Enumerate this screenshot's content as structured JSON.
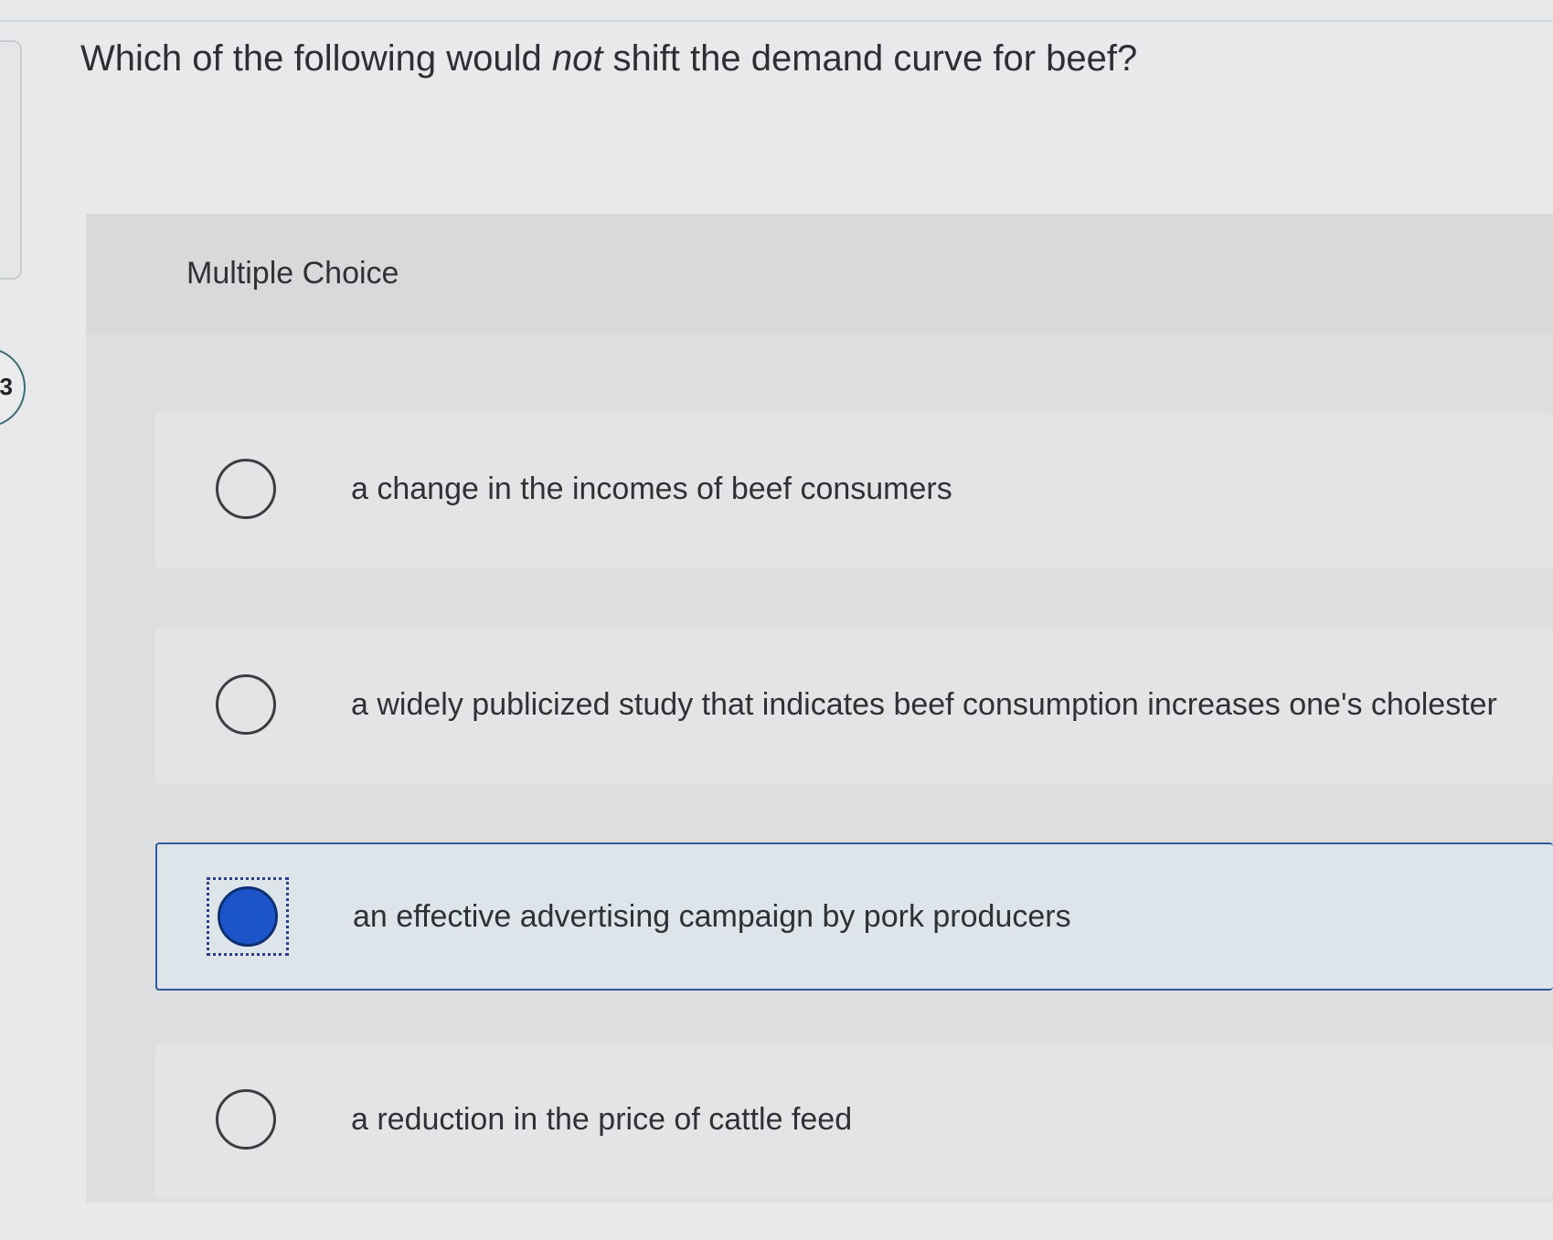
{
  "question": {
    "before": "Which of the following would ",
    "emphasis": "not",
    "after": " shift the demand curve for beef?"
  },
  "left_badge": {
    "label": "3"
  },
  "panel": {
    "label": "Multiple Choice"
  },
  "options": [
    {
      "text": "a change in the incomes of beef consumers",
      "selected": false
    },
    {
      "text": "a widely publicized study that indicates beef consumption increases one's cholester",
      "selected": false
    },
    {
      "text": "an effective advertising campaign by pork producers",
      "selected": true
    },
    {
      "text": "a reduction in the price of cattle feed",
      "selected": false
    }
  ],
  "colors": {
    "selected_fill": "#1b55c9",
    "selected_border": "#2d5b9d"
  }
}
